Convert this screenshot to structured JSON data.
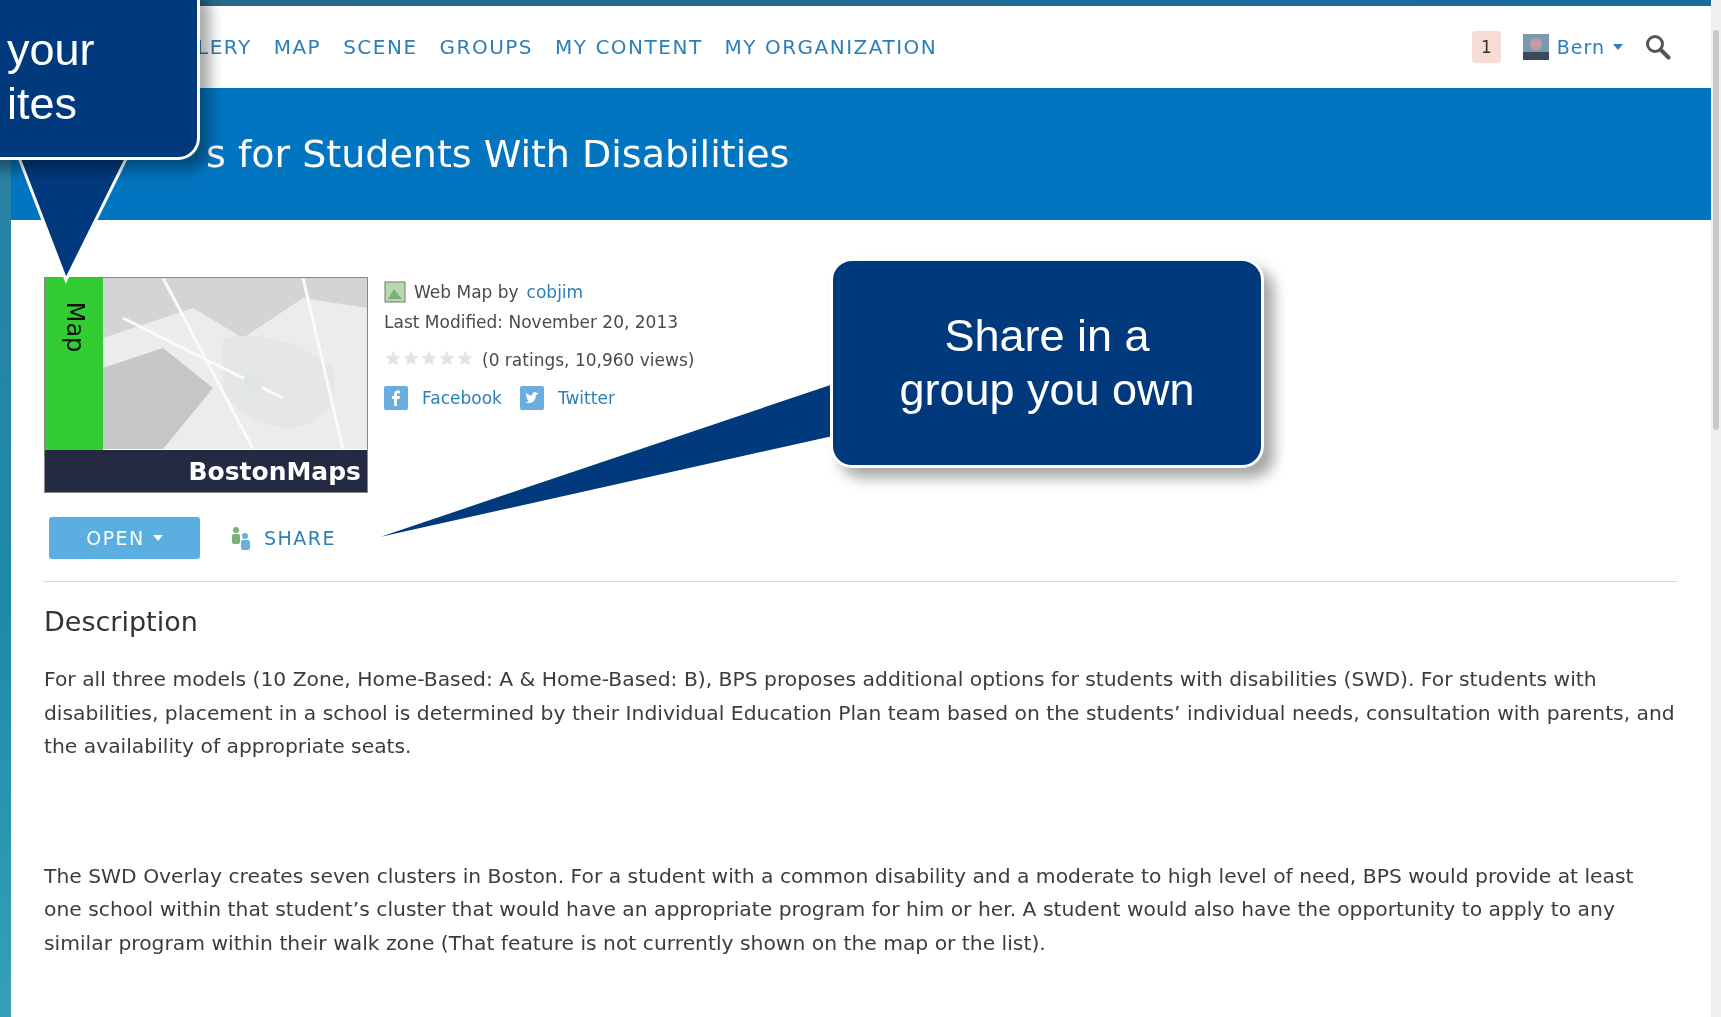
{
  "nav": {
    "items": [
      {
        "label": "LERY",
        "selected": false
      },
      {
        "label": "MAP",
        "selected": false
      },
      {
        "label": "SCENE",
        "selected": false
      },
      {
        "label": "GROUPS",
        "selected": false
      },
      {
        "label": "MY CONTENT",
        "selected": false
      },
      {
        "label": "MY ORGANIZATION",
        "selected": false
      }
    ],
    "notifications": "1",
    "user": "Bern"
  },
  "banner": {
    "title": "s for Students With Disabilities"
  },
  "item": {
    "thumbnail": {
      "side_label": "Map",
      "caption": "BostonMaps"
    },
    "type_prefix": "Web Map by",
    "owner": "cobjim",
    "modified": "Last Modified: November 20, 2013",
    "stars": 0,
    "stats": "(0 ratings, 10,960 views)",
    "social": [
      {
        "kind": "facebook",
        "label": "Facebook"
      },
      {
        "kind": "twitter",
        "label": "Twitter"
      }
    ],
    "open_button": "OPEN",
    "share_link": "SHARE"
  },
  "description": {
    "heading": "Description",
    "paragraphs": [
      "For all three models (10 Zone, Home-Based: A & Home-Based: B), BPS proposes additional options for students with disabilities (SWD).   For students with disabilities, placement in a school is determined by their Individual Education Plan team based on the students’ individual needs, consultation with parents, and the availability of appropriate seats.",
      "The SWD Overlay creates seven clusters in Boston.  For a student with a common disability and a moderate to high level of need, BPS would provide at least one school within that student’s cluster that would have an appropriate program for him or her. A student would also have the opportunity to apply to any similar program within their walk zone (That feature is not currently shown on the map or the list)."
    ]
  },
  "callouts": [
    {
      "kind": "top-left",
      "lines": [
        "your",
        "ites"
      ]
    },
    {
      "kind": "share",
      "lines": [
        "Share in a",
        "group you own"
      ]
    }
  ]
}
